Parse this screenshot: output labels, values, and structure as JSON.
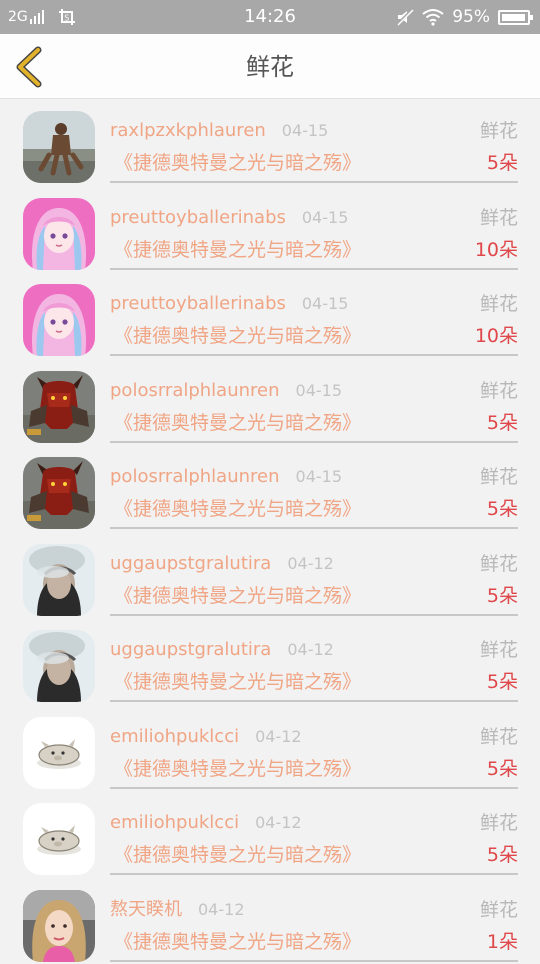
{
  "status_bar": {
    "network": "2G",
    "time": "14:26",
    "battery": "95%",
    "battery_level": 0.95
  },
  "header": {
    "title": "鲜花",
    "back_icon": "chevron-left-icon",
    "accent": "#e2b22a"
  },
  "colors": {
    "name": "#f0a585",
    "date": "#c4c4c4",
    "quantity": "#e0474a",
    "gift_type": "#b8b8b8"
  },
  "records": [
    {
      "user": "raxlpzxkphlauren",
      "date": "04-15",
      "gift": "鲜花",
      "work": "《捷德奥特曼之光与暗之殇》",
      "amount": "5朵",
      "avatar": "beach-man-avatar"
    },
    {
      "user": "preuttoyballerinabs",
      "date": "04-15",
      "gift": "鲜花",
      "work": "《捷德奥特曼之光与暗之殇》",
      "amount": "10朵",
      "avatar": "anime-girl-avatar"
    },
    {
      "user": "preuttoyballerinabs",
      "date": "04-15",
      "gift": "鲜花",
      "work": "《捷德奥特曼之光与暗之殇》",
      "amount": "10朵",
      "avatar": "anime-girl-avatar"
    },
    {
      "user": "polosrralphlaunren",
      "date": "04-15",
      "gift": "鲜花",
      "work": "《捷德奥特曼之光与暗之殇》",
      "amount": "5朵",
      "avatar": "warrior-avatar"
    },
    {
      "user": "polosrralphlaunren",
      "date": "04-15",
      "gift": "鲜花",
      "work": "《捷德奥特曼之光与暗之殇》",
      "amount": "5朵",
      "avatar": "warrior-avatar"
    },
    {
      "user": "uggaupstgralutira",
      "date": "04-12",
      "gift": "鲜花",
      "work": "《捷德奥特曼之光与暗之殇》",
      "amount": "5朵",
      "avatar": "smoke-face-avatar"
    },
    {
      "user": "uggaupstgralutira",
      "date": "04-12",
      "gift": "鲜花",
      "work": "《捷德奥特曼之光与暗之殇》",
      "amount": "5朵",
      "avatar": "smoke-face-avatar"
    },
    {
      "user": "emiliohpuklcci",
      "date": "04-12",
      "gift": "鲜花",
      "work": "《捷德奥特曼之光与暗之殇》",
      "amount": "5朵",
      "avatar": "cartoon-pig-avatar"
    },
    {
      "user": "emiliohpuklcci",
      "date": "04-12",
      "gift": "鲜花",
      "work": "《捷德奥特曼之光与暗之殇》",
      "amount": "5朵",
      "avatar": "cartoon-pig-avatar"
    },
    {
      "user": "熬天睽机",
      "date": "04-12",
      "gift": "鲜花",
      "work": "《捷德奥特曼之光与暗之殇》",
      "amount": "1朵",
      "avatar": "girl-photo-avatar"
    }
  ]
}
